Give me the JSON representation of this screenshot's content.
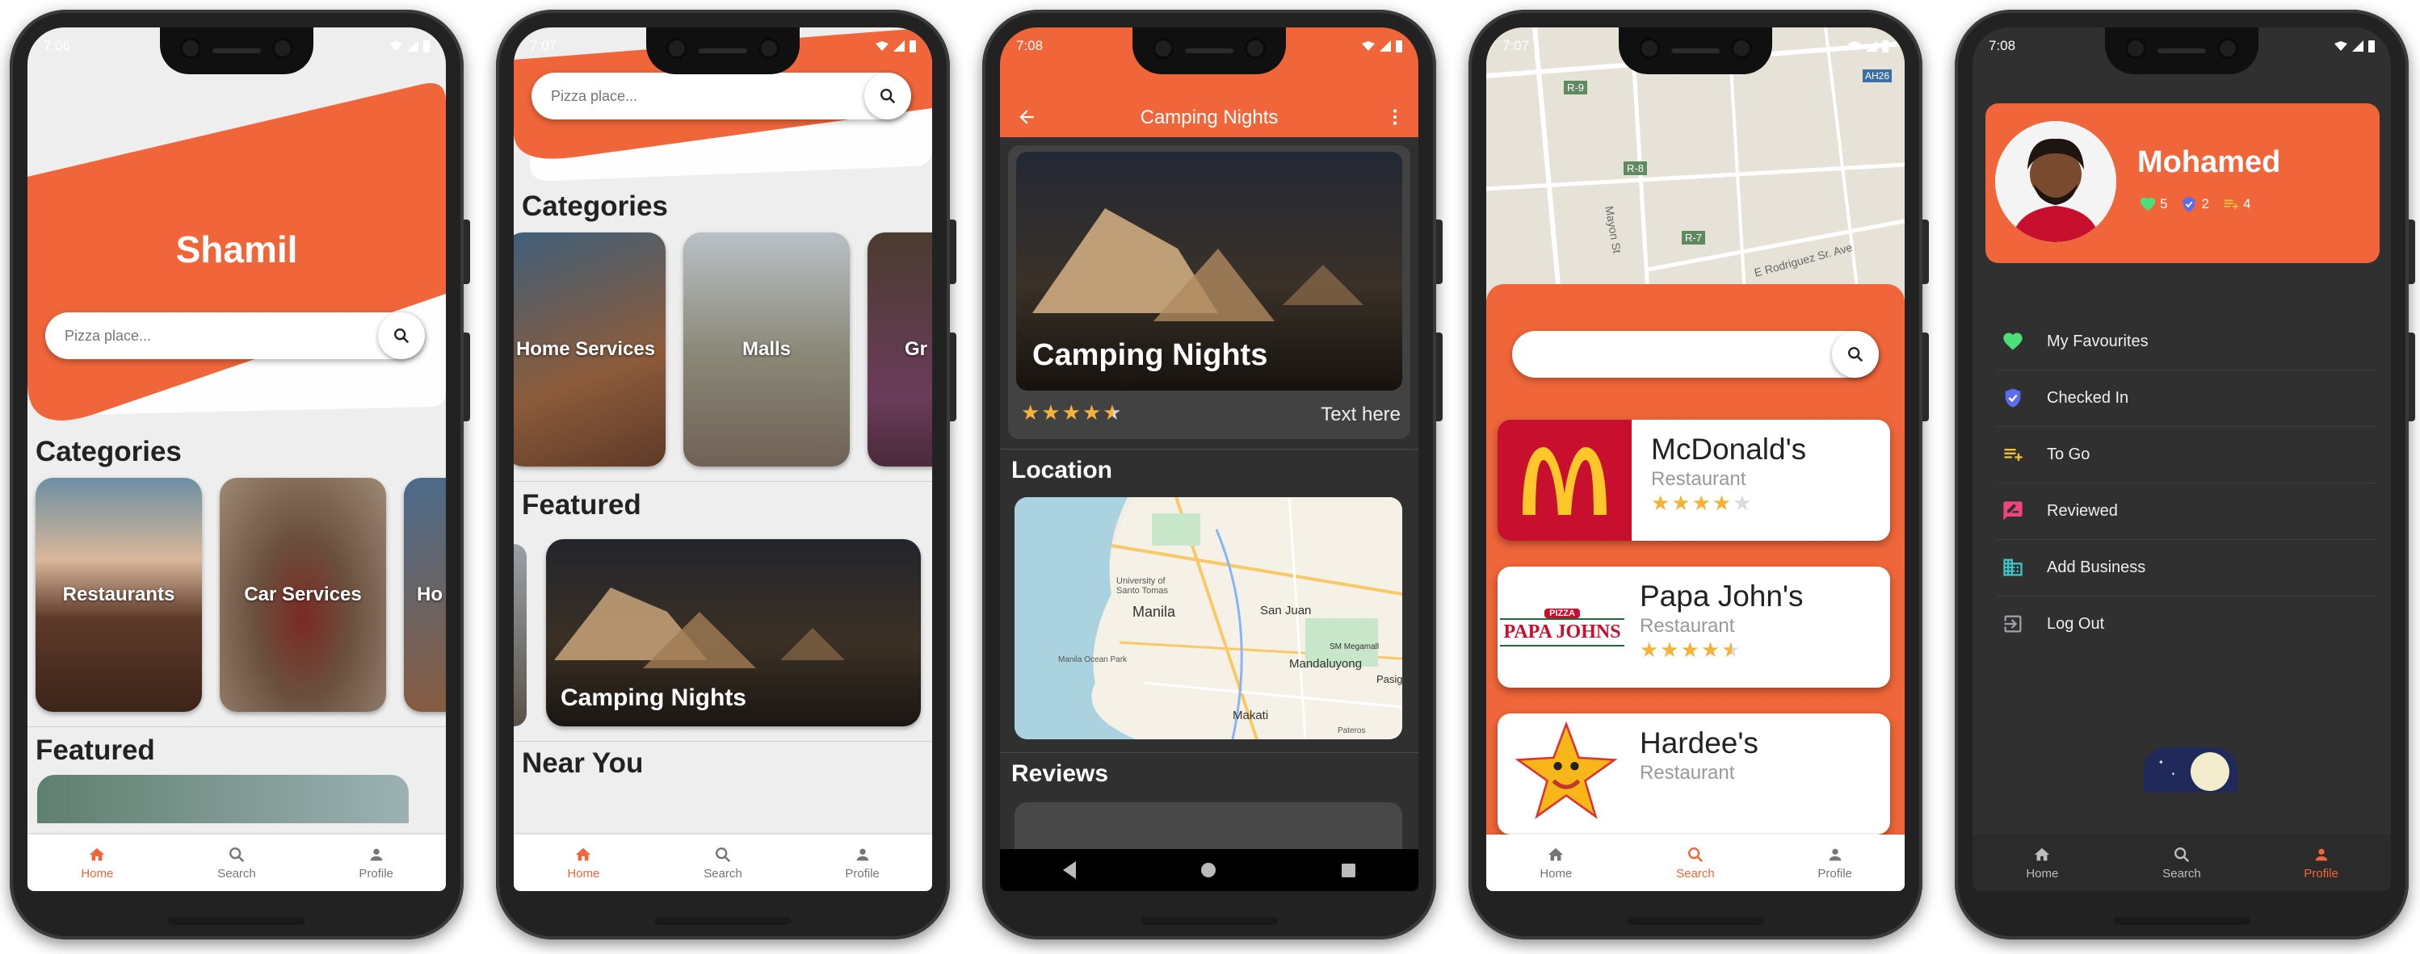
{
  "colors": {
    "accent": "#f0663a",
    "dark_bg": "#303030",
    "light_bg": "#eeeeee",
    "star": "#f3b23a"
  },
  "nav": {
    "home": "Home",
    "search": "Search",
    "profile": "Profile"
  },
  "screen1": {
    "status_time": "7:06",
    "title": "Shamil",
    "search_placeholder": "Pizza place...",
    "categories_title": "Categories",
    "categories": [
      "Restaurants",
      "Car Services",
      "Ho"
    ],
    "featured_title": "Featured"
  },
  "screen2": {
    "status_time": "7:07",
    "search_placeholder": "Pizza place...",
    "categories_title": "Categories",
    "categories": [
      "Home Services",
      "Malls",
      "Gr"
    ],
    "featured_title": "Featured",
    "featured_card": "Camping Nights",
    "near_title": "Near You"
  },
  "screen3": {
    "status_time": "7:08",
    "appbar_title": "Camping Nights",
    "hero_title": "Camping Nights",
    "rating": 4.5,
    "hero_text": "Text here",
    "location_title": "Location",
    "map_labels": [
      "University of Santo Tomas",
      "Manila",
      "San Juan",
      "Mandaluyong",
      "Manila Ocean Park",
      "Makati",
      "Pasig",
      "SM Megamall",
      "Pateros"
    ],
    "reviews_title": "Reviews"
  },
  "screen4": {
    "status_time": "7:07",
    "map_labels": [
      "R-9",
      "R-8",
      "R-7",
      "AH26",
      "Mayon St",
      "E Rodriguez Sr. Ave"
    ],
    "search_placeholder": "",
    "results": [
      {
        "name": "McDonald's",
        "type": "Restaurant",
        "rating": 4,
        "logo": "mcdonalds-logo"
      },
      {
        "name": "Papa John's",
        "type": "Restaurant",
        "rating": 4.5,
        "logo": "papa-johns-logo",
        "logo_text": "PAPA JOHNS",
        "logo_pizza": "PIZZA"
      },
      {
        "name": "Hardee's",
        "type": "Restaurant",
        "rating": 0,
        "logo": "hardees-star-logo"
      }
    ]
  },
  "screen5": {
    "status_time": "7:08",
    "profile_name": "Mohamed",
    "stats": {
      "favourites": "5",
      "checked_in": "2",
      "to_go": "4"
    },
    "menu": [
      "My Favourites",
      "Checked In",
      "To Go",
      "Reviewed",
      "Add Business",
      "Log Out"
    ]
  }
}
